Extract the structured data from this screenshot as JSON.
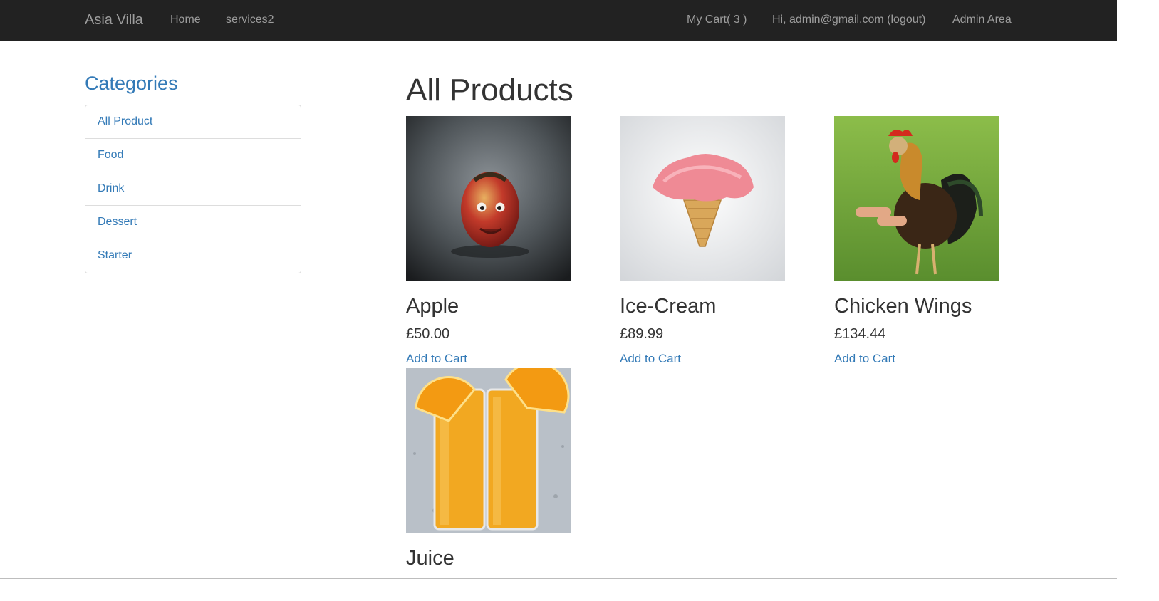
{
  "navbar": {
    "brand": "Asia Villa",
    "links": {
      "home": "Home",
      "services": "services2"
    },
    "cart": "My Cart( 3 )",
    "user": "Hi, admin@gmail.com (logout)",
    "admin": "Admin Area"
  },
  "sidebar": {
    "title": "Categories",
    "items": [
      {
        "label": "All Product"
      },
      {
        "label": "Food"
      },
      {
        "label": "Drink"
      },
      {
        "label": "Dessert"
      },
      {
        "label": "Starter"
      }
    ]
  },
  "main": {
    "heading": "All Products",
    "products": [
      {
        "name": "Apple",
        "price": "£50.00",
        "action": "Add to Cart",
        "image": "apple-with-face-photo"
      },
      {
        "name": "Ice-Cream",
        "price": "£89.99",
        "action": "Add to Cart",
        "image": "strawberry-ice-cream-cone-photo"
      },
      {
        "name": "Chicken Wings",
        "price": "£134.44",
        "action": "Add to Cart",
        "image": "rooster-with-arms-photo"
      },
      {
        "name": "Juice",
        "image": "orange-juice-glasses-photo"
      }
    ]
  },
  "colors": {
    "navbar_bg": "#222222",
    "navbar_text": "#9d9d9d",
    "link": "#337ab7",
    "text": "#333333"
  }
}
